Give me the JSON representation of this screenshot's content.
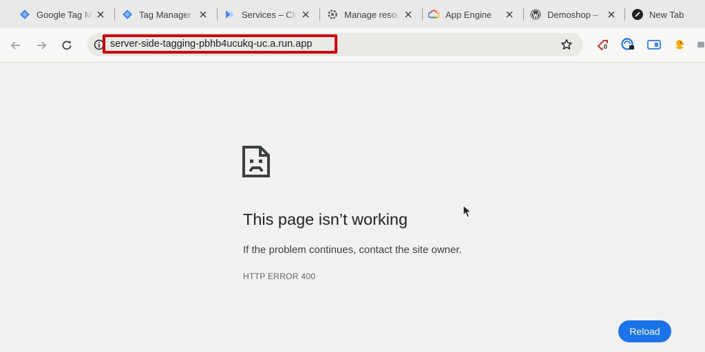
{
  "tabs": [
    {
      "title": "Google Tag Manager",
      "icon": "gtm-diamond-icon"
    },
    {
      "title": "Tag Manager",
      "icon": "gtm-diamond-icon"
    },
    {
      "title": "Services – Cloud Run",
      "icon": "cloud-run-icon"
    },
    {
      "title": "Manage resources",
      "icon": "gear-icon"
    },
    {
      "title": "App Engine",
      "icon": "google-cloud-icon"
    },
    {
      "title": "Demoshop – ",
      "icon": "wordpress-icon"
    },
    {
      "title": "New Tab",
      "icon": "new-tab-icon"
    }
  ],
  "address_bar": {
    "url": "server-side-tagging-pbhb4ucukq-uc.a.run.app"
  },
  "extensions": {
    "badge_count": "0"
  },
  "error_page": {
    "heading": "This page isn’t working",
    "message": "If the problem continues, contact the site owner.",
    "error_code": "HTTP ERROR 400",
    "reload_label": "Reload"
  },
  "colors": {
    "highlight": "#d3000b",
    "reload_button": "#1a73e8",
    "background": "#f1f1ef"
  }
}
